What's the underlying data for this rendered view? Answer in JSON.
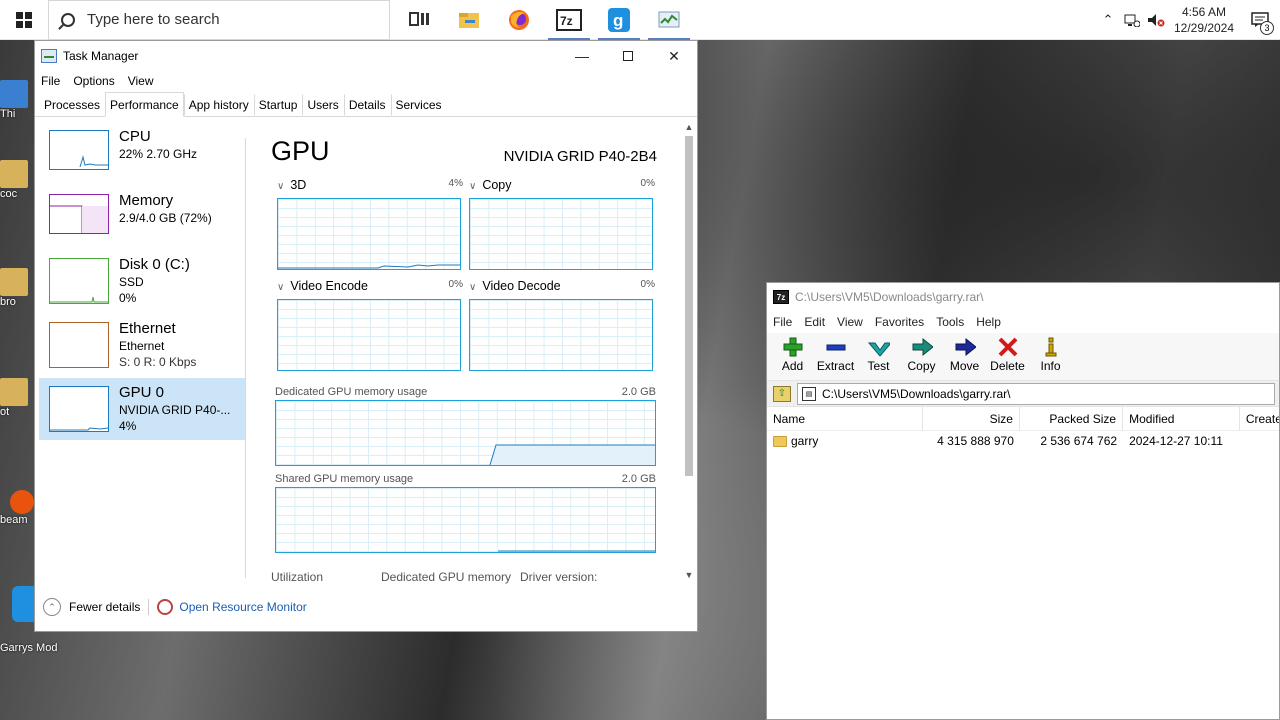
{
  "taskbar": {
    "search_placeholder": "Type here to search",
    "apps": [
      {
        "icon": "task-view-icon"
      },
      {
        "icon": "file-explorer-icon"
      },
      {
        "icon": "firefox-icon"
      },
      {
        "icon": "7zip-icon"
      },
      {
        "icon": "garrys-mod-icon"
      },
      {
        "icon": "task-manager-icon"
      }
    ],
    "time": "4:56 AM",
    "date": "12/29/2024",
    "notification_count": "3"
  },
  "desktop": {
    "icons": [
      {
        "label": "Thi"
      },
      {
        "label": "coc"
      },
      {
        "label": "bro"
      },
      {
        "label": "ot"
      },
      {
        "label": "beam"
      },
      {
        "label": "Garrys Mod"
      }
    ]
  },
  "task_manager": {
    "title": "Task Manager",
    "menu": [
      "File",
      "Options",
      "View"
    ],
    "tabs": [
      "Processes",
      "Performance",
      "App history",
      "Startup",
      "Users",
      "Details",
      "Services"
    ],
    "active_tab": "Performance",
    "sidebar": [
      {
        "name": "CPU",
        "line2": "22% 2.70 GHz",
        "line3": "",
        "color": "#1c7bbf"
      },
      {
        "name": "Memory",
        "line2": "2.9/4.0 GB (72%)",
        "line3": "",
        "color": "#8b22a8"
      },
      {
        "name": "Disk 0 (C:)",
        "line2": "SSD",
        "line3": "0%",
        "color": "#4aa83a"
      },
      {
        "name": "Ethernet",
        "line2": "Ethernet",
        "line3": "S: 0 R: 0 Kbps",
        "color": "#a8642a"
      },
      {
        "name": "GPU 0",
        "line2": "NVIDIA GRID P40-...",
        "line3": "4%",
        "color": "#1c7bbf"
      }
    ],
    "gpu": {
      "title": "GPU",
      "model": "NVIDIA GRID P40-2B4",
      "engines": [
        {
          "name": "3D",
          "percent": "4%",
          "level": 0.04
        },
        {
          "name": "Copy",
          "percent": "0%",
          "level": 0
        },
        {
          "name": "Video Encode",
          "percent": "0%",
          "level": 0
        },
        {
          "name": "Video Decode",
          "percent": "0%",
          "level": 0
        }
      ],
      "dedicated_label": "Dedicated GPU memory usage",
      "dedicated_max": "2.0 GB",
      "shared_label": "Shared GPU memory usage",
      "shared_max": "2.0 GB",
      "stat_labels": [
        "Utilization",
        "Dedicated GPU memory",
        "Driver version:"
      ]
    },
    "footer": {
      "fewer_details": "Fewer details",
      "open_resource_monitor": "Open Resource Monitor"
    }
  },
  "sevenzip": {
    "title": "C:\\Users\\VM5\\Downloads\\garry.rar\\",
    "menu": [
      "File",
      "Edit",
      "View",
      "Favorites",
      "Tools",
      "Help"
    ],
    "toolbar": [
      {
        "label": "Add",
        "icon": "plus-icon",
        "color": "#2aa12a"
      },
      {
        "label": "Extract",
        "icon": "minus-icon",
        "color": "#1d3fbf"
      },
      {
        "label": "Test",
        "icon": "check-icon",
        "color": "#1aa6a6"
      },
      {
        "label": "Copy",
        "icon": "copy-arrow-icon",
        "color": "#1a8a7a"
      },
      {
        "label": "Move",
        "icon": "move-arrow-icon",
        "color": "#1d2a9a"
      },
      {
        "label": "Delete",
        "icon": "x-icon",
        "color": "#d11a1a"
      },
      {
        "label": "Info",
        "icon": "info-icon",
        "color": "#c9a500"
      }
    ],
    "address": "C:\\Users\\VM5\\Downloads\\garry.rar\\",
    "columns": [
      "Name",
      "Size",
      "Packed Size",
      "Modified",
      "Created"
    ],
    "rows": [
      {
        "name": "garry",
        "size": "4 315 888 970",
        "packed": "2 536 674 762",
        "modified": "2024-12-27 10:11",
        "created": ""
      }
    ]
  }
}
